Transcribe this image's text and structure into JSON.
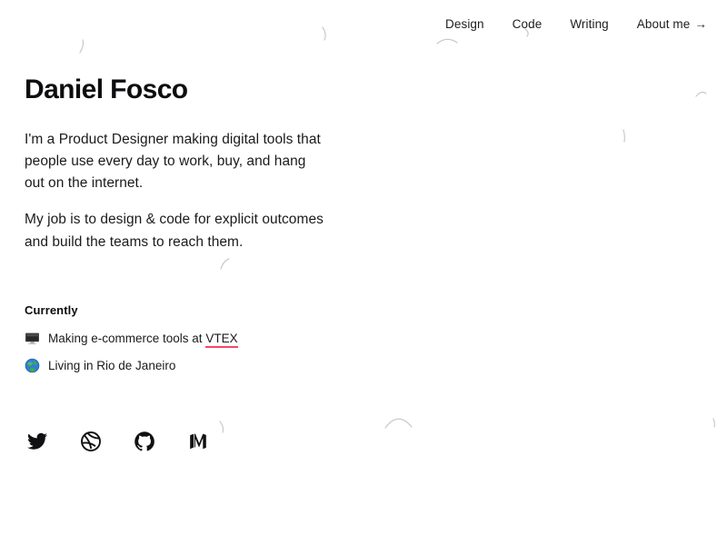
{
  "nav": {
    "items": [
      {
        "label": "Design",
        "name": "nav-link-design"
      },
      {
        "label": "Code",
        "name": "nav-link-code"
      },
      {
        "label": "Writing",
        "name": "nav-link-writing"
      },
      {
        "label": "About me",
        "name": "nav-link-about-me"
      }
    ],
    "about_arrow": "→"
  },
  "hero": {
    "title": "Daniel Fosco",
    "paragraph_1": "I'm a Product Designer making digital tools that people use every day to work, buy, and hang out on the internet.",
    "paragraph_2": "My job is to design & code for explicit outcomes and build the teams to reach them."
  },
  "currently": {
    "heading": "Currently",
    "items": [
      {
        "emoji_name": "desktop-computer-emoji",
        "text_before": "Making e-commerce tools at ",
        "link_label": "VTEX",
        "text_after": ""
      },
      {
        "emoji_name": "globe-earth-emoji",
        "text_before": "Living in Rio de Janeiro",
        "link_label": "",
        "text_after": ""
      }
    ]
  },
  "socials": [
    {
      "label": "Twitter",
      "icon": "twitter-icon"
    },
    {
      "label": "Dribbble",
      "icon": "dribbble-icon"
    },
    {
      "label": "GitHub",
      "icon": "github-icon"
    },
    {
      "label": "Medium",
      "icon": "medium-icon"
    }
  ],
  "colors": {
    "background": "#ffffff",
    "text": "#1b1b1e",
    "heading": "#0d0d0f",
    "link_underline": "#f8456b",
    "scribble": "#c9c9cd"
  }
}
